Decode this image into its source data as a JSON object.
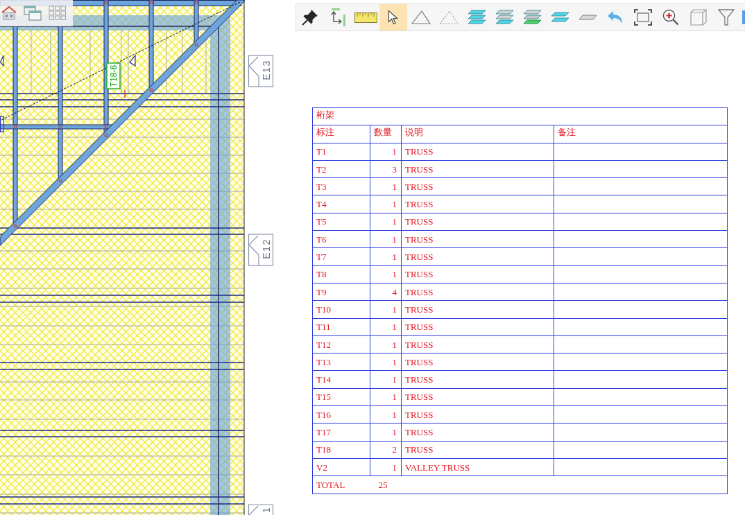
{
  "drawing": {
    "truss_tag": "T18-6",
    "elevation_markers": [
      "E13",
      "E12",
      "1"
    ]
  },
  "toolbar": {
    "tools": [
      {
        "selected": false
      },
      {
        "selected": false
      },
      {
        "selected": false
      },
      {
        "selected": true
      },
      {
        "selected": false
      },
      {
        "selected": false
      },
      {
        "selected": false
      },
      {
        "selected": false
      },
      {
        "selected": false
      },
      {
        "selected": false
      },
      {
        "selected": false
      },
      {
        "selected": false
      },
      {
        "selected": false
      },
      {
        "selected": false
      },
      {
        "selected": false
      },
      {
        "selected": false
      },
      {
        "selected": false
      }
    ]
  },
  "table": {
    "title": "桁架",
    "columns": [
      "标注",
      "数量",
      "说明",
      "备注"
    ],
    "rows": [
      {
        "mark": "T1",
        "qty": "1",
        "description": "TRUSS"
      },
      {
        "mark": "T2",
        "qty": "3",
        "description": "TRUSS"
      },
      {
        "mark": "T3",
        "qty": "1",
        "description": "TRUSS"
      },
      {
        "mark": "T4",
        "qty": "1",
        "description": "TRUSS"
      },
      {
        "mark": "T5",
        "qty": "1",
        "description": "TRUSS"
      },
      {
        "mark": "T6",
        "qty": "1",
        "description": "TRUSS"
      },
      {
        "mark": "T7",
        "qty": "1",
        "description": "TRUSS"
      },
      {
        "mark": "T8",
        "qty": "1",
        "description": "TRUSS"
      },
      {
        "mark": "T9",
        "qty": "4",
        "description": "TRUSS"
      },
      {
        "mark": "T10",
        "qty": "1",
        "description": "TRUSS"
      },
      {
        "mark": "T11",
        "qty": "1",
        "description": "TRUSS"
      },
      {
        "mark": "T12",
        "qty": "1",
        "description": "TRUSS"
      },
      {
        "mark": "T13",
        "qty": "1",
        "description": "TRUSS"
      },
      {
        "mark": "T14",
        "qty": "1",
        "description": "TRUSS"
      },
      {
        "mark": "T15",
        "qty": "1",
        "description": "TRUSS"
      },
      {
        "mark": "T16",
        "qty": "1",
        "description": "TRUSS"
      },
      {
        "mark": "T17",
        "qty": "1",
        "description": "TRUSS"
      },
      {
        "mark": "T18",
        "qty": "2",
        "description": "TRUSS"
      },
      {
        "mark": "V2",
        "qty": "1",
        "description": "VALLEY TRUSS"
      }
    ],
    "total": {
      "label": "TOTAL",
      "value": "25"
    }
  }
}
